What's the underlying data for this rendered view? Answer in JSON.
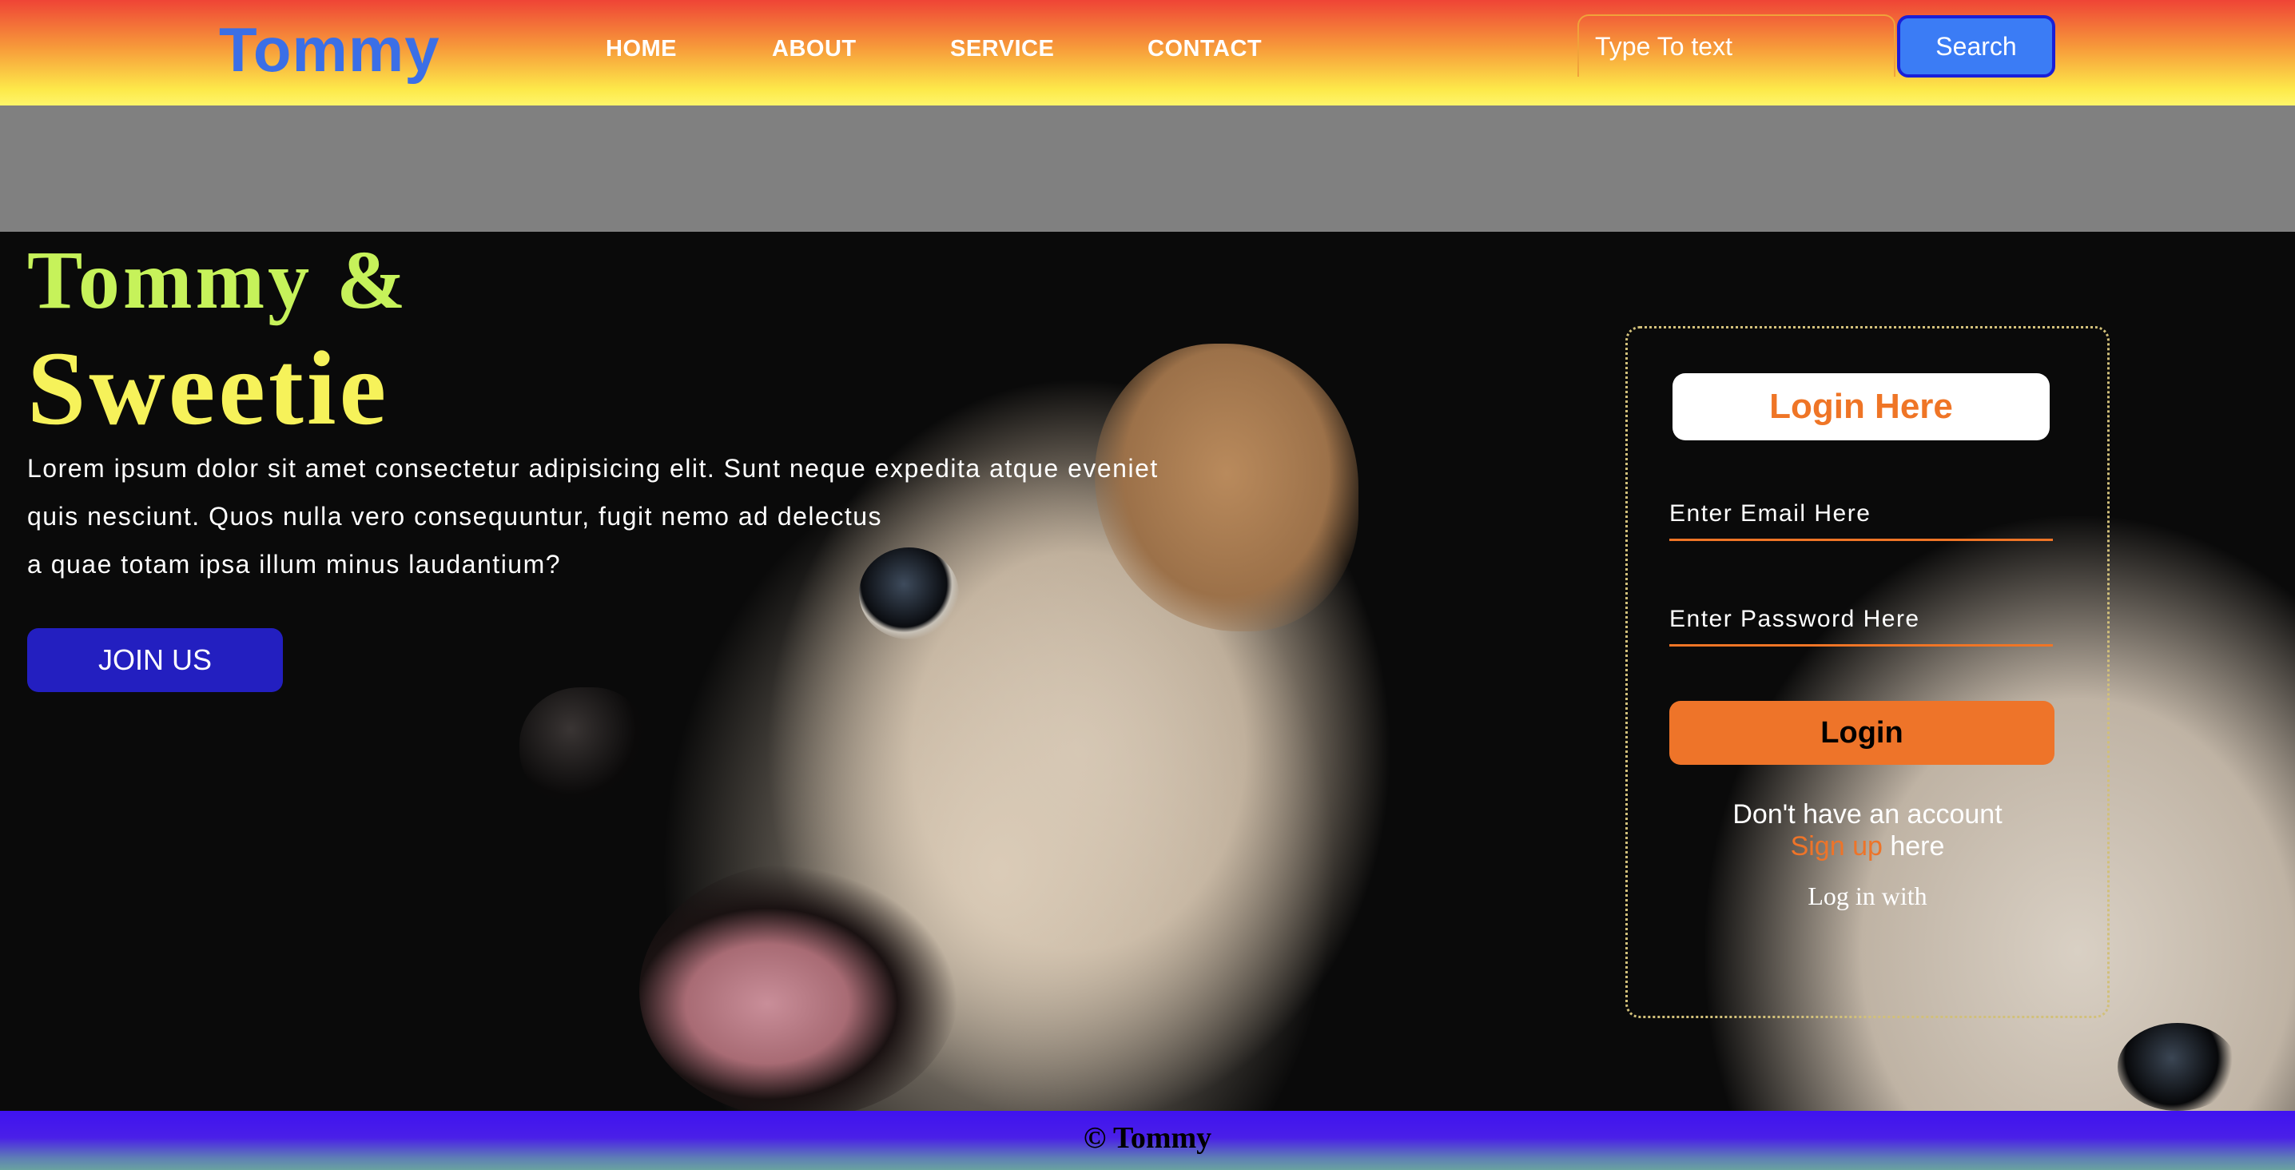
{
  "navbar": {
    "logo": "Tommy",
    "links": [
      {
        "label": "HOME"
      },
      {
        "label": "ABOUT"
      },
      {
        "label": "SERVICE"
      },
      {
        "label": "CONTACT"
      }
    ],
    "search_placeholder": "Type To text",
    "search_button": "Search"
  },
  "hero": {
    "title_line1": "Tommy &",
    "title_line2": "Sweetie",
    "paragraph_lines": [
      "Lorem ipsum dolor sit amet consectetur adipisicing elit. Sunt neque expedita atque eveniet",
      "quis nesciunt. Quos nulla vero consequuntur, fugit nemo ad delectus",
      "a quae totam ipsa illum minus laudantium?"
    ],
    "join_button": "JOIN US"
  },
  "login": {
    "title": "Login Here",
    "email_placeholder": "Enter Email Here",
    "password_placeholder": "Enter Password Here",
    "login_button": "Login",
    "no_account_text": "Don't have an account",
    "signup_link": "Sign up",
    "signup_suffix": " here",
    "login_with": "Log in with"
  },
  "footer": {
    "text": "© Tommy"
  },
  "colors": {
    "logo": "#3b6fe6",
    "accent_orange": "#ee7429",
    "search_button": "#3b7cf5",
    "join_button": "#231fc0",
    "title_green": "#c6f25a",
    "title_yellow": "#f6f25a"
  }
}
